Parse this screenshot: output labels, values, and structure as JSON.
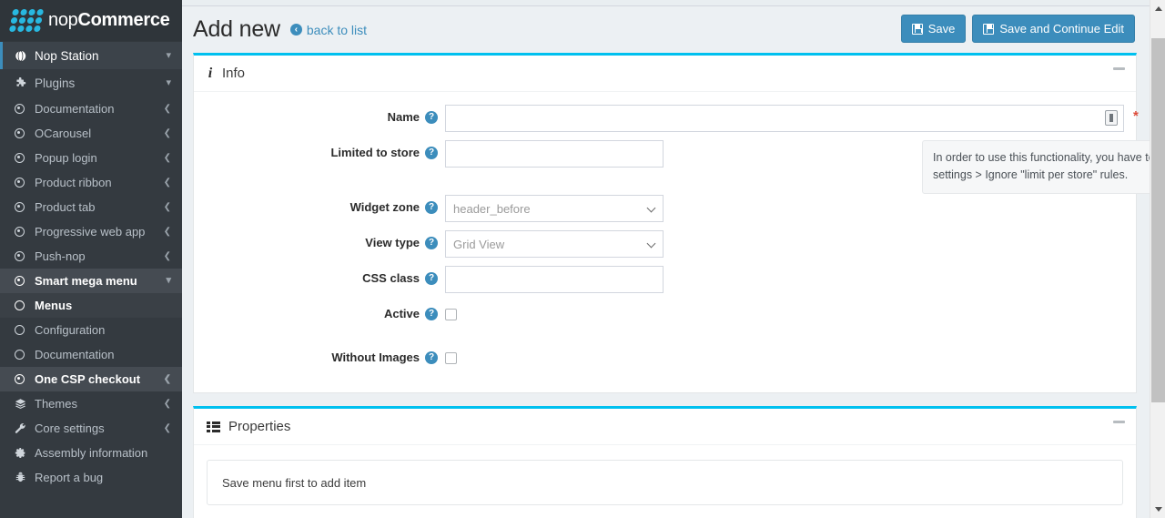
{
  "brand": {
    "name_light": "nop",
    "name_bold": "Commerce",
    "logo_icon": "dots-logo-icon"
  },
  "sidebar": {
    "items": [
      {
        "label": "Nop Station",
        "icon": "globe-icon",
        "arrow": "chevron-down",
        "state": "active-root",
        "level": 1
      },
      {
        "label": "Plugins",
        "icon": "puzzle-icon",
        "arrow": "chevron-down",
        "state": "normal",
        "level": 1
      },
      {
        "label": "Documentation",
        "icon": "radio-dot-icon",
        "arrow": "chevron-left",
        "state": "normal",
        "level": 2
      },
      {
        "label": "OCarousel",
        "icon": "radio-dot-icon",
        "arrow": "chevron-left",
        "state": "normal",
        "level": 2
      },
      {
        "label": "Popup login",
        "icon": "radio-dot-icon",
        "arrow": "chevron-left",
        "state": "normal",
        "level": 2
      },
      {
        "label": "Product ribbon",
        "icon": "radio-dot-icon",
        "arrow": "chevron-left",
        "state": "normal",
        "level": 2
      },
      {
        "label": "Product tab",
        "icon": "radio-dot-icon",
        "arrow": "chevron-left",
        "state": "normal",
        "level": 2
      },
      {
        "label": "Progressive web app",
        "icon": "radio-dot-icon",
        "arrow": "chevron-left",
        "state": "normal",
        "level": 2
      },
      {
        "label": "Push-nop",
        "icon": "radio-dot-icon",
        "arrow": "chevron-left",
        "state": "normal",
        "level": 2
      },
      {
        "label": "Smart mega menu",
        "icon": "radio-dot-icon",
        "arrow": "chevron-down",
        "state": "selected",
        "level": 2
      },
      {
        "label": "Menus",
        "icon": "circle-icon",
        "arrow": "",
        "state": "current",
        "level": 3
      },
      {
        "label": "Configuration",
        "icon": "circle-icon",
        "arrow": "",
        "state": "normal",
        "level": 3
      },
      {
        "label": "Documentation",
        "icon": "circle-icon",
        "arrow": "",
        "state": "normal",
        "level": 3
      },
      {
        "label": "One CSP checkout",
        "icon": "radio-dot-icon",
        "arrow": "chevron-left",
        "state": "selected",
        "level": 2
      },
      {
        "label": "Themes",
        "icon": "layers-icon",
        "arrow": "chevron-left",
        "state": "normal",
        "level": 2
      },
      {
        "label": "Core settings",
        "icon": "wrench-icon",
        "arrow": "chevron-left",
        "state": "normal",
        "level": 2
      },
      {
        "label": "Assembly information",
        "icon": "gear-icon",
        "arrow": "",
        "state": "normal",
        "level": 2
      },
      {
        "label": "Report a bug",
        "icon": "bug-icon",
        "arrow": "",
        "state": "normal",
        "level": 2
      }
    ]
  },
  "header": {
    "title": "Add new",
    "back_link": "back to list",
    "back_icon": "arrow-left-circle-icon",
    "save_label": "Save",
    "save_continue_label": "Save and Continue Edit",
    "save_icon": "floppy-disk-icon"
  },
  "info_panel": {
    "title": "Info",
    "icon": "info-icon",
    "collapse_icon": "minus-icon",
    "fields": {
      "name": {
        "label": "Name",
        "value": "",
        "required": true,
        "help_icon": "question-mark-icon",
        "localize_icon": "localization-icon"
      },
      "limited_to_store": {
        "label": "Limited to store",
        "value": "",
        "help_icon": "question-mark-icon",
        "hint": "In order to use this functionality, you have to disable the following setting: Catalog settings > Ignore \"limit per store\" rules."
      },
      "widget_zone": {
        "label": "Widget zone",
        "value": "header_before",
        "help_icon": "question-mark-icon",
        "chevron": "chevron-down-icon"
      },
      "view_type": {
        "label": "View type",
        "value": "Grid View",
        "help_icon": "question-mark-icon",
        "chevron": "chevron-down-icon"
      },
      "css_class": {
        "label": "CSS class",
        "value": "",
        "help_icon": "question-mark-icon"
      },
      "active": {
        "label": "Active",
        "checked": false,
        "help_icon": "question-mark-icon"
      },
      "without_images": {
        "label": "Without Images",
        "checked": false,
        "help_icon": "question-mark-icon"
      }
    }
  },
  "properties_panel": {
    "title": "Properties",
    "icon": "table-list-icon",
    "collapse_icon": "minus-icon",
    "empty_message": "Save menu first to add item"
  },
  "colors": {
    "accent": "#00c0ef",
    "primary": "#3c8dbc",
    "sidebar_bg": "#343a40",
    "page_bg": "#ecf0f3",
    "required": "#dd4b39"
  },
  "scrollbar": {
    "up_icon": "triangle-up-icon",
    "down_icon": "triangle-down-icon"
  }
}
